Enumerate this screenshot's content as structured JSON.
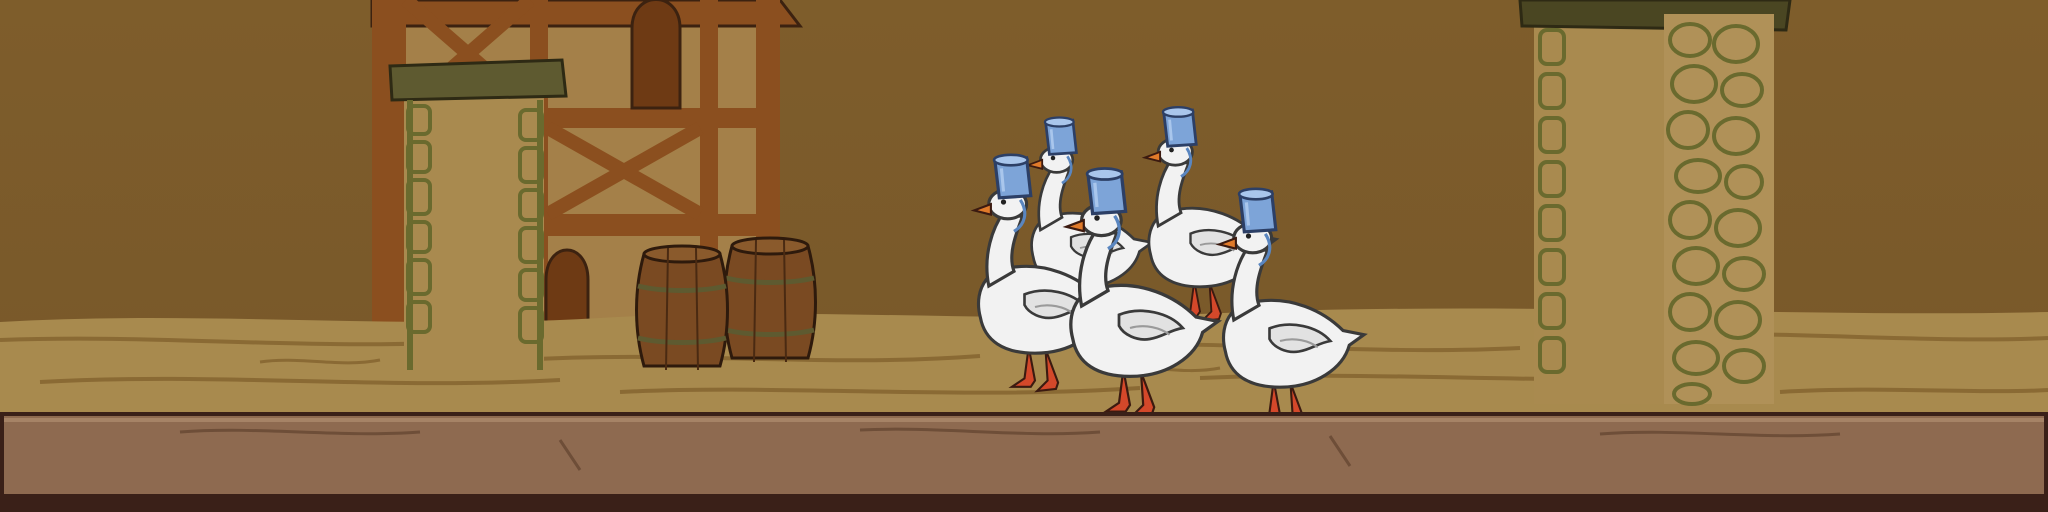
{
  "scene": {
    "name": "village-street",
    "colors": {
      "sky_wall": "#7a5a2a",
      "ground_light": "#a88a4e",
      "ground_dark": "#8a6a34",
      "stone_tan": "#a98a4f",
      "stone_outline": "#6a6a2e",
      "timber": "#8b4f1f",
      "plaster": "#a48049",
      "barrel": "#7a4a22",
      "bucket": "#7da4d8",
      "goose_body": "#f2f2f2",
      "goose_beak": "#e07a2a",
      "goose_legs": "#d4482a",
      "platform": "#8e6a50",
      "platform_edge": "#3a2018"
    }
  },
  "characters": {
    "geese": [
      {
        "type": "goose",
        "accessory": "bucket-helmet"
      },
      {
        "type": "goose",
        "accessory": "bucket-helmet"
      },
      {
        "type": "goose",
        "accessory": "bucket-helmet"
      },
      {
        "type": "goose",
        "accessory": "bucket-helmet"
      },
      {
        "type": "goose",
        "accessory": "bucket-helmet"
      }
    ]
  },
  "props": {
    "barrels": 2,
    "pillars": 2,
    "building": "timber-frame-house"
  }
}
